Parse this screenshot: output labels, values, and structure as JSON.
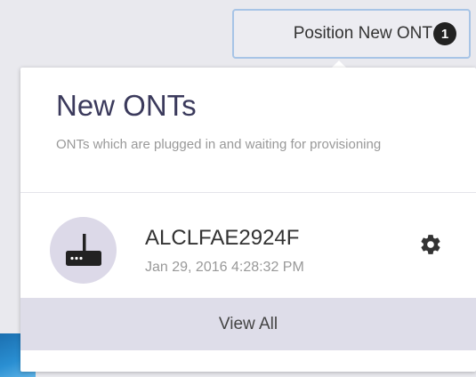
{
  "header": {
    "position_button_label": "Position New ONT",
    "new_count": "1"
  },
  "panel": {
    "title": "New ONTs",
    "subtitle": "ONTs which are plugged in and waiting for provisioning",
    "items": [
      {
        "serial": "ALCLFAE2924F",
        "timestamp": "Jan 29, 2016 4:28:32 PM",
        "icon": "router-icon",
        "action_icon": "gear-icon"
      }
    ],
    "view_all_label": "View All"
  },
  "colors": {
    "title": "#3b3a5c",
    "subtitle": "#999999",
    "avatar_bg": "#dcd9e8",
    "view_all_bg": "#dedde9",
    "button_border": "#a7c4e6",
    "badge_bg": "#222222"
  }
}
